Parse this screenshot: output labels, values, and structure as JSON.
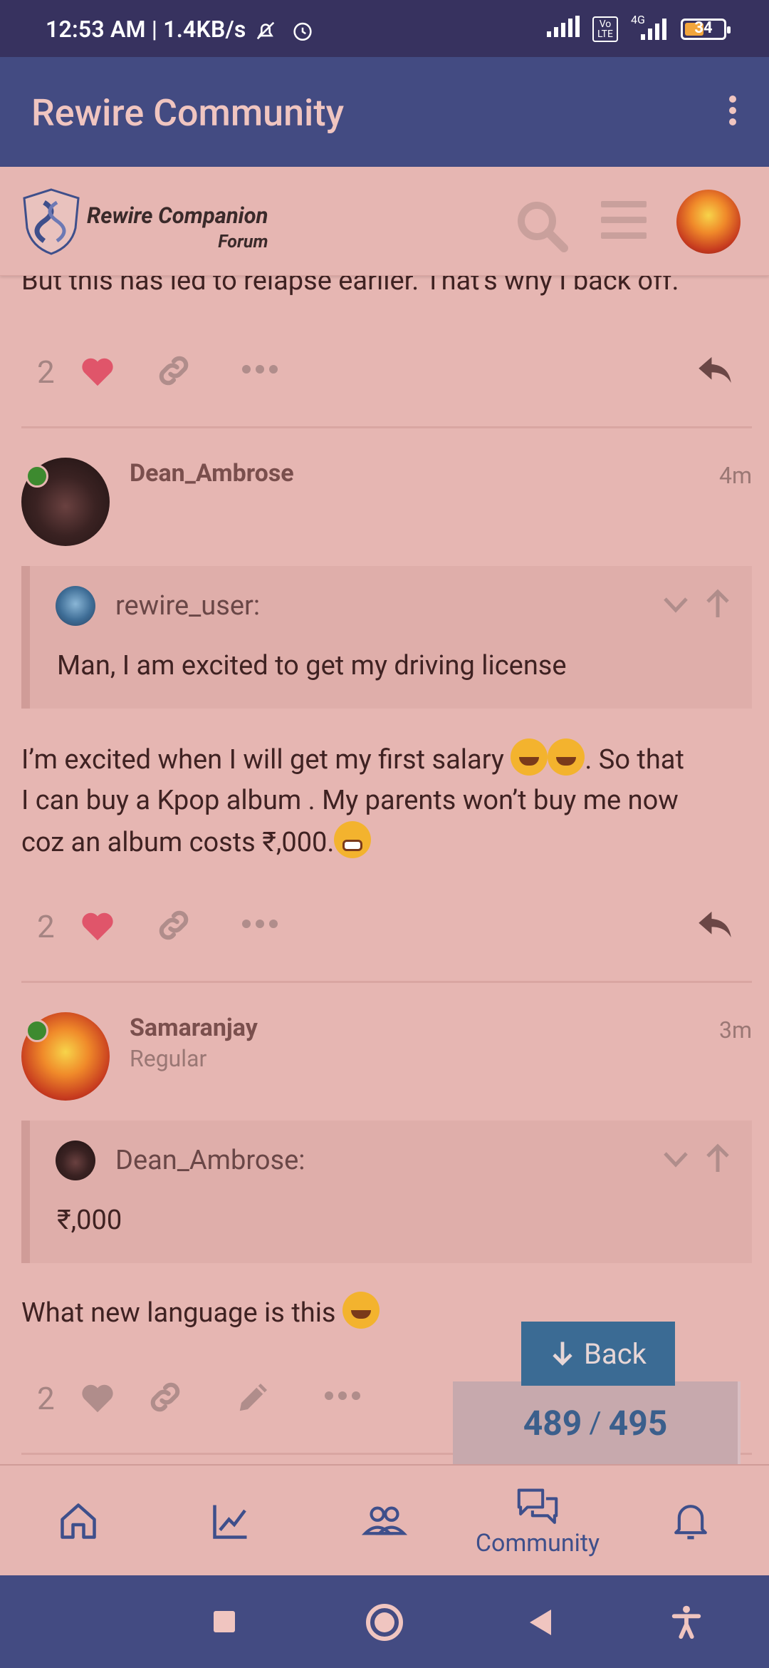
{
  "status_bar": {
    "time": "12:53 AM | 1.4KB/s",
    "network": "4G",
    "volte": "Vo LTE",
    "battery": "34"
  },
  "app_bar": {
    "title": "Rewire Community"
  },
  "forum_header": {
    "logo_line1": "Rewire Companion",
    "logo_line2": "Forum"
  },
  "posts": [
    {
      "body": "But this has led to relapse earlier. That’s why I back off.",
      "likes": "2"
    },
    {
      "username": "Dean_Ambrose",
      "time": "4m",
      "quote": {
        "author": "rewire_user:",
        "text": "Man, I am excited to get my driving license"
      },
      "body_line1_a": "I’m excited when I will get my first salary ",
      "body_line1_b": ". So that",
      "body_line2": "I can buy a Kpop album . My parents won’t buy me now",
      "body_line3": "coz an album costs ₹,000.",
      "likes": "2"
    },
    {
      "username": "Samaranjay",
      "user_title": "Regular",
      "time": "3m",
      "quote": {
        "author": "Dean_Ambrose:",
        "text": "₹,000"
      },
      "body": "What new language is this ",
      "likes": "2"
    }
  ],
  "back_button": {
    "label": "Back"
  },
  "progress": {
    "current": "489",
    "separator": "/",
    "total": "495"
  },
  "bottom_nav": {
    "active_label": "Community"
  },
  "colors": {
    "app_bar": "#434b82",
    "status_bar": "#37325f",
    "background": "#e6b6b2",
    "heart": "#e0556a",
    "accent_blue": "#3b6b94",
    "online": "#3d8a2f"
  }
}
